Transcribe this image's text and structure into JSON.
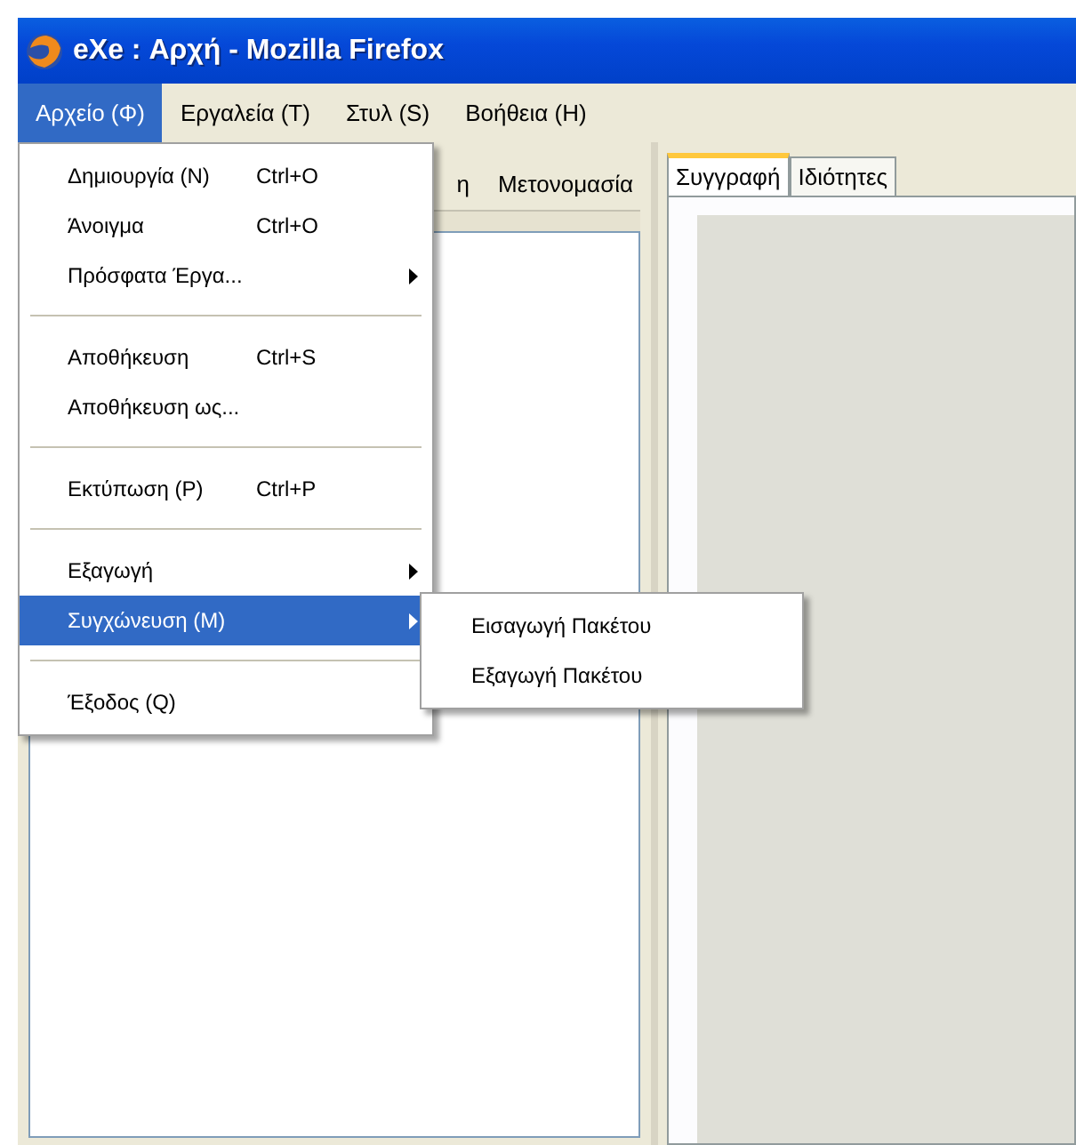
{
  "window": {
    "title": "eXe : Αρχή - Mozilla Firefox"
  },
  "menubar": [
    {
      "label": "Αρχείο (Φ)",
      "selected": true
    },
    {
      "label": "Εργαλεία (T)",
      "selected": false
    },
    {
      "label": "Στυλ (S)",
      "selected": false
    },
    {
      "label": "Βοήθεια (H)",
      "selected": false
    }
  ],
  "file_menu": [
    {
      "kind": "item",
      "label": "Δημιουργία (N)",
      "shortcut": "Ctrl+O",
      "submenu": false,
      "selected": false
    },
    {
      "kind": "item",
      "label": "Άνοιγμα",
      "shortcut": "Ctrl+O",
      "submenu": false,
      "selected": false
    },
    {
      "kind": "item",
      "label": "Πρόσφατα Έργα...",
      "submenu": true,
      "selected": false
    },
    {
      "kind": "separator"
    },
    {
      "kind": "item",
      "label": "Αποθήκευση",
      "shortcut": "Ctrl+S",
      "submenu": false,
      "selected": false
    },
    {
      "kind": "item",
      "label": "Αποθήκευση ως...",
      "submenu": false,
      "selected": false
    },
    {
      "kind": "separator"
    },
    {
      "kind": "item",
      "label": "Εκτύπωση (P)",
      "shortcut": "Ctrl+P",
      "submenu": false,
      "selected": false
    },
    {
      "kind": "separator"
    },
    {
      "kind": "item",
      "label": "Εξαγωγή",
      "submenu": true,
      "selected": false
    },
    {
      "kind": "item",
      "label": "Συγχώνευση (M)",
      "submenu": true,
      "selected": true
    },
    {
      "kind": "separator"
    },
    {
      "kind": "item",
      "label": "Έξοδος (Q)",
      "submenu": false,
      "selected": false
    }
  ],
  "submenu": [
    {
      "label": "Εισαγωγή Πακέτου"
    },
    {
      "label": "Εξαγωγή Πακέτου"
    }
  ],
  "outline_toolbar": [
    "η",
    "Μετονομασία"
  ],
  "tabs": [
    {
      "label": "Συγγραφή",
      "selected": true
    },
    {
      "label": "Ιδιότητες",
      "selected": false
    }
  ]
}
